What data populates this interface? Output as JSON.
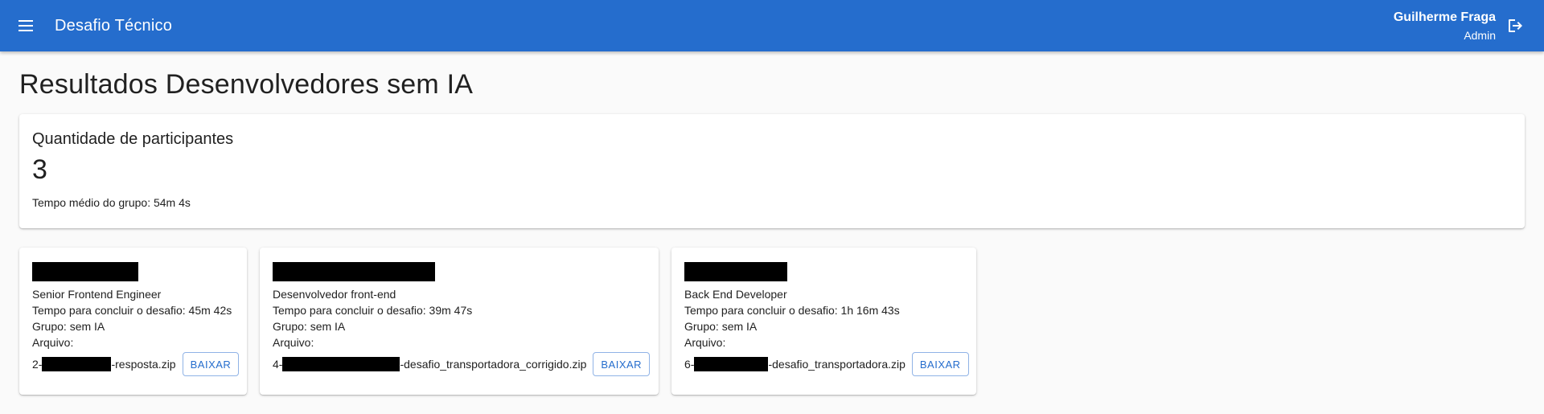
{
  "header": {
    "title": "Desafio Técnico",
    "user_name": "Guilherme Fraga",
    "user_role": "Admin"
  },
  "page_title": "Resultados Desenvolvedores sem IA",
  "summary": {
    "label": "Quantidade de participantes",
    "count": "3",
    "average_time": "Tempo médio do grupo: 54m 4s"
  },
  "participants": [
    {
      "role": "Senior Frontend Engineer",
      "time": "Tempo para concluir o desafio: 45m 42s",
      "group": "Grupo: sem IA",
      "file_label": "Arquivo:",
      "file_prefix": "2-",
      "file_suffix": "-resposta.zip",
      "button": "BAIXAR"
    },
    {
      "role": "Desenvolvedor front-end",
      "time": "Tempo para concluir o desafio: 39m 47s",
      "group": "Grupo: sem IA",
      "file_label": "Arquivo:",
      "file_prefix": "4-",
      "file_suffix": "-desafio_transportadora_corrigido.zip",
      "button": "BAIXAR"
    },
    {
      "role": "Back End Developer",
      "time": "Tempo para concluir o desafio: 1h 16m 43s",
      "group": "Grupo: sem IA",
      "file_label": "Arquivo:",
      "file_prefix": "6-",
      "file_suffix": "-desafio_transportadora.zip",
      "button": "BAIXAR"
    }
  ],
  "colors": {
    "primary": "#256dcd",
    "background": "#fafafa"
  },
  "icons": {
    "menu": "menu-icon",
    "logout": "logout-icon"
  }
}
